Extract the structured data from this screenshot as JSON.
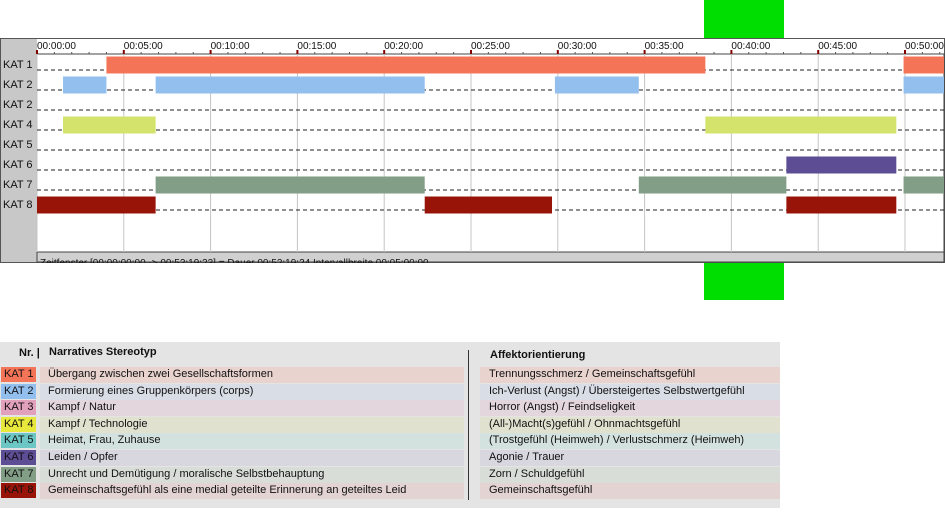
{
  "colors": {
    "highlight": "#00dd00",
    "kat1": "#f47458",
    "kat2": "#93bfee",
    "kat4": "#d3e36b",
    "kat6": "#5c4d94",
    "kat7": "#829e86",
    "kat8": "#981408"
  },
  "chart_data": {
    "type": "timeline",
    "x_unit": "time (hh:mm:ss)",
    "x_range": [
      "00:00:00",
      "00:52:19"
    ],
    "x_ticks": [
      "00:00:00",
      "00:05:00",
      "00:10:00",
      "00:15:00",
      "00:20:00",
      "00:25:00",
      "00:30:00",
      "00:35:00",
      "00:40:00",
      "00:45:00",
      "00:50:00"
    ],
    "rows": [
      "KAT 1",
      "KAT 2",
      "KAT 2",
      "KAT 4",
      "KAT 5",
      "KAT 6",
      "KAT 7",
      "KAT 8"
    ],
    "series": [
      {
        "row": 0,
        "color_key": "kat1",
        "segments": [
          [
            "00:04:00",
            "00:38:30"
          ],
          [
            "00:49:55",
            "00:52:19"
          ]
        ]
      },
      {
        "row": 1,
        "color_key": "kat2",
        "segments": [
          [
            "00:01:30",
            "00:04:00"
          ],
          [
            "00:06:50",
            "00:22:20"
          ],
          [
            "00:29:50",
            "00:34:40"
          ],
          [
            "00:49:55",
            "00:52:19"
          ]
        ]
      },
      {
        "row": 2,
        "color_key": "kat2",
        "segments": []
      },
      {
        "row": 3,
        "color_key": "kat4",
        "segments": [
          [
            "00:01:30",
            "00:06:50"
          ],
          [
            "00:38:30",
            "00:49:30"
          ]
        ]
      },
      {
        "row": 4,
        "color_key": "kat4",
        "segments": []
      },
      {
        "row": 5,
        "color_key": "kat6",
        "segments": [
          [
            "00:43:10",
            "00:49:30"
          ]
        ]
      },
      {
        "row": 6,
        "color_key": "kat7",
        "segments": [
          [
            "00:06:50",
            "00:22:20"
          ],
          [
            "00:34:40",
            "00:43:10"
          ],
          [
            "00:49:55",
            "00:52:19"
          ]
        ]
      },
      {
        "row": 7,
        "color_key": "kat8",
        "segments": [
          [
            "00:00:00",
            "00:06:50"
          ],
          [
            "00:22:20",
            "00:29:40"
          ],
          [
            "00:43:10",
            "00:49:30"
          ]
        ]
      }
    ],
    "status": "Zeitfenster [00:00:00:00 -> 00:52:19:23] = Dauer 00:52:19:24    Intervallbreite 00:05:00:00"
  },
  "legend": {
    "header_nr": "Nr. |",
    "header_stereotype": "Narratives Stereotyp",
    "header_affect": "Affektorientierung",
    "rows": [
      {
        "tag": "KAT 1",
        "tag_color": "#f47458",
        "row_color": "#e8d3cf",
        "desc": "Übergang zwischen zwei Gesellschaftsformen",
        "affect": "Trennungsschmerz / Gemeinschaftsgefühl"
      },
      {
        "tag": "KAT 2",
        "tag_color": "#93bfee",
        "row_color": "#d8dde6",
        "desc": "Formierung eines Gruppenkörpers (corps)",
        "affect": "Ich-Verlust (Angst) / Übersteigertes Selbstwertgefühl"
      },
      {
        "tag": "KAT 3",
        "tag_color": "#e1a0bb",
        "row_color": "#e3d6dc",
        "desc": "Kampf / Natur",
        "affect": "Horror (Angst) / Feindseligkeit"
      },
      {
        "tag": "KAT 4",
        "tag_color": "#e8e83c",
        "row_color": "#e0e1cf",
        "desc": "Kampf / Technologie",
        "affect": "(All-)Macht(s)gefühl / Ohnmachtsgefühl"
      },
      {
        "tag": "KAT 5",
        "tag_color": "#6cc6c3",
        "row_color": "#d4e2df",
        "desc": "Heimat, Frau, Zuhause",
        "affect": "(Trostgefühl (Heimweh) / Verlustschmerz (Heimweh)"
      },
      {
        "tag": "KAT 6",
        "tag_color": "#5c4d94",
        "row_color": "#d8d6df",
        "desc": "Leiden / Opfer",
        "affect": "Agonie / Trauer"
      },
      {
        "tag": "KAT 7",
        "tag_color": "#829e86",
        "row_color": "#d8ddd8",
        "desc": "Unrecht und Demütigung / moralische Selbstbehauptung",
        "affect": "Zorn / Schuldgefühl"
      },
      {
        "tag": "KAT 8",
        "tag_color": "#981408",
        "row_color": "#e3d3d3",
        "desc": "Gemeinschaftsgefühl als eine medial geteilte Erinnerung an geteiltes Leid",
        "affect": "Gemeinschaftsgefühl"
      }
    ]
  }
}
